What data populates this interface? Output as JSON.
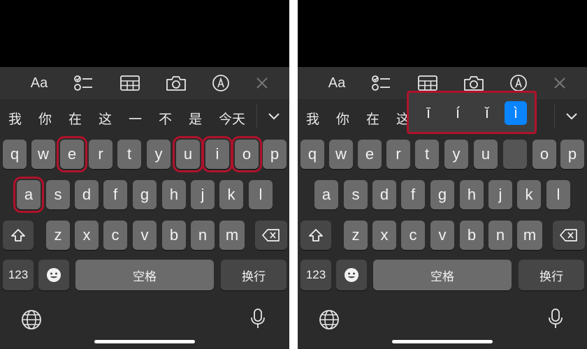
{
  "toolbar": {
    "format_label": "Aa"
  },
  "candidates": [
    "我",
    "你",
    "在",
    "这",
    "一",
    "不",
    "是",
    "今天"
  ],
  "rows": {
    "row1": [
      "q",
      "w",
      "e",
      "r",
      "t",
      "y",
      "u",
      "i",
      "o",
      "p"
    ],
    "row2": [
      "a",
      "s",
      "d",
      "f",
      "g",
      "h",
      "j",
      "k",
      "l"
    ],
    "row3": [
      "z",
      "x",
      "c",
      "v",
      "b",
      "n",
      "m"
    ]
  },
  "highlighted_keys_left": [
    "e",
    "u",
    "i",
    "o",
    "a"
  ],
  "keys": {
    "numbers": "123",
    "space": "空格",
    "return": "换行"
  },
  "tone_popup": {
    "options": [
      "ī",
      "í",
      "ǐ",
      "ì"
    ],
    "selected": "ì"
  },
  "colors": {
    "highlight_border": "#b0122b",
    "selected_tone": "#0a84ff",
    "key": "#6b6b6b",
    "background": "#2b2b2b"
  }
}
